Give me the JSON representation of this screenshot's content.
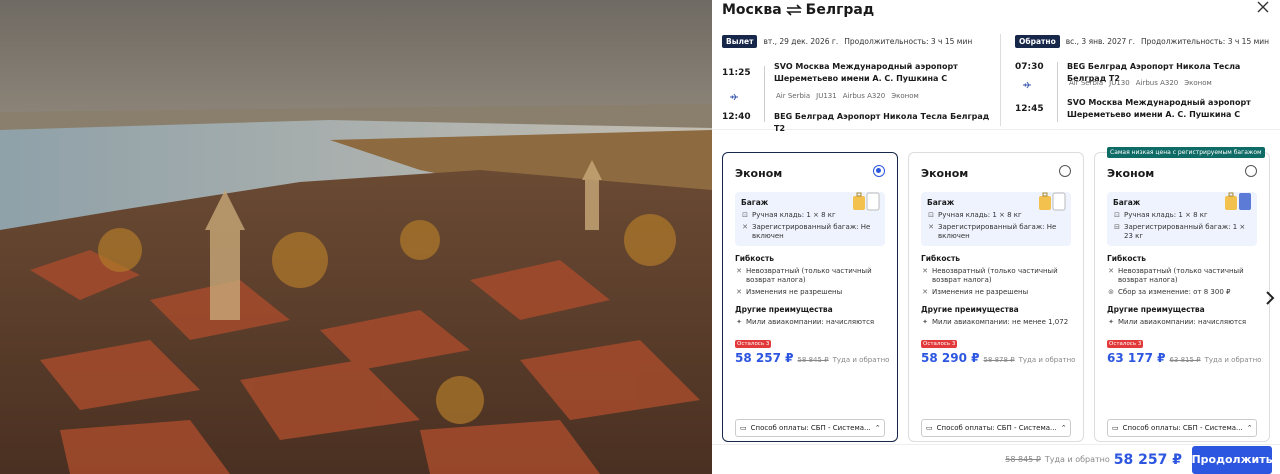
{
  "title": {
    "from": "Москва",
    "to": "Белград"
  },
  "outbound": {
    "tag": "Вылет",
    "date": "вт., 29 дек. 2026 г.",
    "duration": "Продолжительность: 3 ч 15 мин",
    "dep_time": "11:25",
    "arr_time": "12:40",
    "dep_airport_line1": "SVO Москва Международный аэропорт",
    "dep_airport_line2": "Шереметьево имени А. С. Пушкина С",
    "arr_airport": "BEG Белград Аэропорт Никола Тесла Белград T2",
    "airline": "Air Serbia",
    "flight": "JU131",
    "aircraft": "Airbus A320",
    "cabin": "Эконом"
  },
  "inbound": {
    "tag": "Обратно",
    "date": "вс., 3 янв. 2027 г.",
    "duration": "Продолжительность: 3 ч 15 мин",
    "dep_time": "07:30",
    "arr_time": "12:45",
    "dep_airport": "BEG Белград Аэропорт Никола Тесла Белград T2",
    "arr_airport_line1": "SVO Москва Международный аэропорт",
    "arr_airport_line2": "Шереметьево имени А. С. Пушкина С",
    "airline": "Air Serbia",
    "flight": "JU130",
    "aircraft": "Airbus A320",
    "cabin": "Эконом"
  },
  "fares": [
    {
      "name": "Эконом",
      "baggage_title": "Багаж",
      "hand": "Ручная кладь: 1 × 8 кг",
      "checked": "Зарегистрированный багаж: Не включен",
      "flex_title": "Гибкость",
      "flex1": "Невозвратный (только частичный возврат налога)",
      "flex2": "Изменения не разрешены",
      "other_title": "Другие преимущества",
      "miles": "Мили авиакомпании: начисляются",
      "left": "Осталось 3",
      "price": "58 257 ₽",
      "old": "58 845 ₽",
      "rt": "Туда и обратно",
      "pay": "Способ оплаты: СБП - Система..."
    },
    {
      "name": "Эконом",
      "baggage_title": "Багаж",
      "hand": "Ручная кладь: 1 × 8 кг",
      "checked": "Зарегистрированный багаж: Не включен",
      "flex_title": "Гибкость",
      "flex1": "Невозвратный (только частичный возврат налога)",
      "flex2": "Изменения не разрешены",
      "other_title": "Другие преимущества",
      "miles": "Мили авиакомпании: не менее 1,072",
      "left": "Осталось 3",
      "price": "58 290 ₽",
      "old": "58 878 ₽",
      "rt": "Туда и обратно",
      "pay": "Способ оплаты: СБП - Система..."
    },
    {
      "name": "Эконом",
      "promo": "Самая низкая цена с регистрируемым багажом",
      "baggage_title": "Багаж",
      "hand": "Ручная кладь: 1 × 8 кг",
      "checked": "Зарегистрированный багаж: 1 × 23 кг",
      "flex_title": "Гибкость",
      "flex1": "Невозвратный (только частичный возврат налога)",
      "flex2": "Сбор за изменение: от 8 300 ₽",
      "other_title": "Другие преимущества",
      "miles": "Мили авиакомпании: начисляются",
      "left": "Осталось 3",
      "price": "63 177 ₽",
      "old": "63 815 ₽",
      "rt": "Туда и обратно",
      "pay": "Способ оплаты: СБП - Система..."
    }
  ],
  "footer": {
    "old": "58 845 ₽",
    "rt": "Туда и обратно",
    "total": "58 257 ₽",
    "cta": "Продолжить"
  },
  "colors": {
    "accent": "#2d56e0",
    "navy": "#16274a",
    "promo": "#0f6b66",
    "badge": "#e23a3a"
  }
}
